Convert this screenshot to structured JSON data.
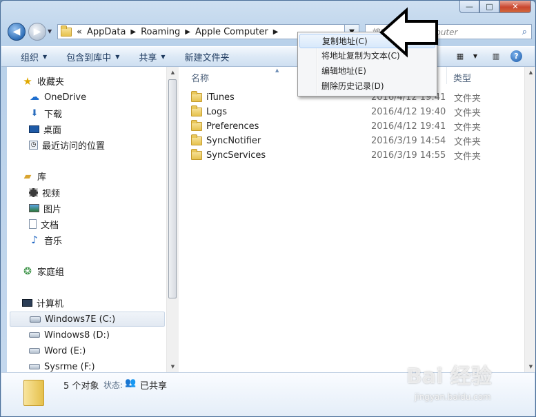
{
  "window": {
    "minimize_glyph": "—",
    "maximize_glyph": "□",
    "close_glyph": "✕"
  },
  "nav": {
    "back_glyph": "◀",
    "forward_glyph": "▶",
    "dropdown_glyph": "▼",
    "address": {
      "overflow": "«",
      "crumbs": [
        "AppData",
        "Roaming",
        "Apple Computer"
      ],
      "sep_glyph": "▶"
    },
    "search_placeholder": "搜索 Apple Computer"
  },
  "toolbar": {
    "organize": "组织",
    "include_library": "包含到库中",
    "share": "共享",
    "new_folder": "新建文件夹",
    "view_icon": "view-icon",
    "preview_icon": "preview-pane-icon",
    "help_glyph": "?"
  },
  "sidebar": {
    "favorites": {
      "label": "收藏夹",
      "items": [
        "OneDrive",
        "下载",
        "桌面",
        "最近访问的位置"
      ]
    },
    "libraries": {
      "label": "库",
      "items": [
        "视频",
        "图片",
        "文档",
        "音乐"
      ]
    },
    "homegroup": "家庭组",
    "computer": {
      "label": "计算机",
      "drives": [
        "Windows7E (C:)",
        "Windows8 (D:)",
        "Word (E:)",
        "Sysrme (F:)"
      ]
    }
  },
  "columns": {
    "name": "名称",
    "type": "类型"
  },
  "files": [
    {
      "name": "iTunes",
      "date": "2016/4/12 19:41",
      "type": "文件夹"
    },
    {
      "name": "Logs",
      "date": "2016/4/12 19:40",
      "type": "文件夹"
    },
    {
      "name": "Preferences",
      "date": "2016/4/12 19:41",
      "type": "文件夹"
    },
    {
      "name": "SyncNotifier",
      "date": "2016/3/19 14:54",
      "type": "文件夹"
    },
    {
      "name": "SyncServices",
      "date": "2016/3/19 14:55",
      "type": "文件夹"
    }
  ],
  "details": {
    "count": "5 个对象",
    "status_label": "状态:",
    "status_value": "已共享"
  },
  "context_menu": {
    "items": [
      "复制地址(C)",
      "将地址复制为文本(C)",
      "编辑地址(E)",
      "删除历史记录(D)"
    ],
    "highlighted_index": 0
  },
  "watermark": {
    "main": "Bai 经验",
    "sub": "jingyan.baidu.com"
  },
  "colors": {
    "accent": "#2f6fb8",
    "hover": "#d8e9fb"
  }
}
